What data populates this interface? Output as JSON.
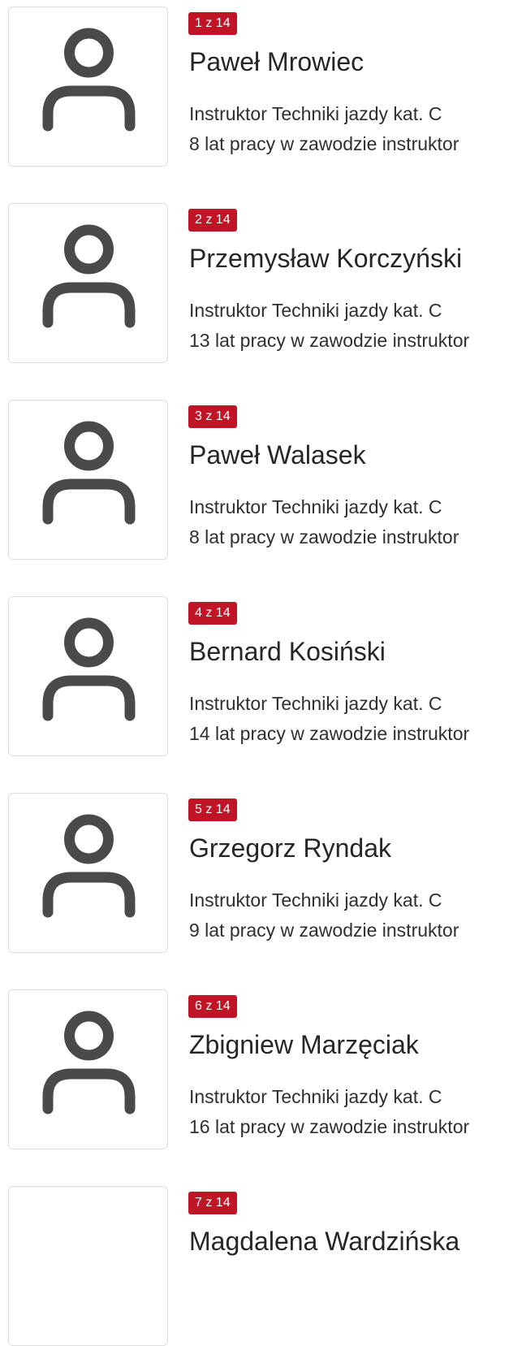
{
  "instructors": [
    {
      "badge": "1 z 14",
      "name": "Paweł Mrowiec",
      "role": "Instruktor Techniki jazdy kat. C",
      "experience": "8 lat pracy w zawodzie instruktor",
      "avatar_icon": "user-placeholder-icon"
    },
    {
      "badge": "2 z 14",
      "name": "Przemysław Korczyński",
      "role": "Instruktor Techniki jazdy kat. C",
      "experience": "13 lat pracy w zawodzie instruktor",
      "avatar_icon": "user-placeholder-icon"
    },
    {
      "badge": "3 z 14",
      "name": "Paweł Walasek",
      "role": "Instruktor Techniki jazdy kat. C",
      "experience": "8 lat pracy w zawodzie instruktor",
      "avatar_icon": "user-placeholder-icon"
    },
    {
      "badge": "4 z 14",
      "name": "Bernard Kosiński",
      "role": "Instruktor Techniki jazdy kat. C",
      "experience": "14 lat pracy w zawodzie instruktor",
      "avatar_icon": "user-placeholder-icon"
    },
    {
      "badge": "5 z 14",
      "name": "Grzegorz Ryndak",
      "role": "Instruktor Techniki jazdy kat. C",
      "experience": "9 lat pracy w zawodzie instruktor",
      "avatar_icon": "user-placeholder-icon"
    },
    {
      "badge": "6 z 14",
      "name": "Zbigniew Marzęciak",
      "role": "Instruktor Techniki jazdy kat. C",
      "experience": "16 lat pracy w zawodzie instruktor",
      "avatar_icon": "user-placeholder-icon"
    },
    {
      "badge": "7 z 14",
      "name": "Magdalena Wardzińska",
      "role": "",
      "experience": "",
      "avatar_icon": ""
    }
  ],
  "colors": {
    "badge_bg": "#c01527",
    "badge_text": "#ffffff",
    "icon": "#4a4a4a",
    "avatar_border": "#dedede",
    "text": "#262626"
  }
}
